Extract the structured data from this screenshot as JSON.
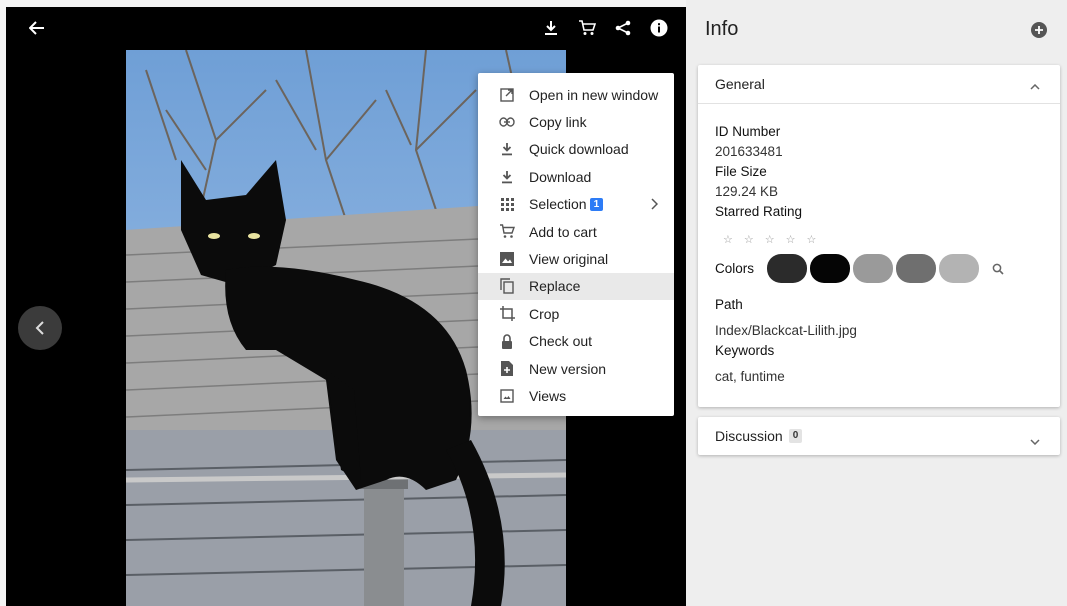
{
  "viewer": {
    "menu": [
      {
        "icon": "open-new-window-icon",
        "label": "Open in new window"
      },
      {
        "icon": "link-icon",
        "label": "Copy link"
      },
      {
        "icon": "download-icon",
        "label": "Quick download"
      },
      {
        "icon": "download-icon",
        "label": "Download"
      },
      {
        "icon": "grid-icon",
        "label": "Selection",
        "badge": "1"
      },
      {
        "icon": "cart-icon",
        "label": "Add to cart"
      },
      {
        "icon": "image-icon",
        "label": "View original"
      },
      {
        "icon": "copy-icon",
        "label": "Replace"
      },
      {
        "icon": "crop-icon",
        "label": "Crop"
      },
      {
        "icon": "lock-icon",
        "label": "Check out"
      },
      {
        "icon": "new-file-icon",
        "label": "New version"
      },
      {
        "icon": "views-icon",
        "label": "Views"
      }
    ]
  },
  "info": {
    "title": "Info",
    "general": {
      "header": "General",
      "id_label": "ID Number",
      "id_value": "201633481",
      "size_label": "File Size",
      "size_value": "129.24 KB",
      "rating_label": "Starred Rating",
      "stars": [
        "☆",
        "☆",
        "☆",
        "☆",
        "☆"
      ],
      "colors_label": "Colors",
      "colors": [
        "#2b2b2b",
        "#050505",
        "#9a9a9a",
        "#6f6f6f",
        "#b3b3b3"
      ],
      "path_label": "Path",
      "path_root": "Index",
      "path_sep": "/",
      "path_file": "Blackcat-Lilith.jpg",
      "keywords_label": "Keywords",
      "keywords_value": "cat, funtime"
    },
    "discussion": {
      "header": "Discussion",
      "count": "0"
    }
  }
}
